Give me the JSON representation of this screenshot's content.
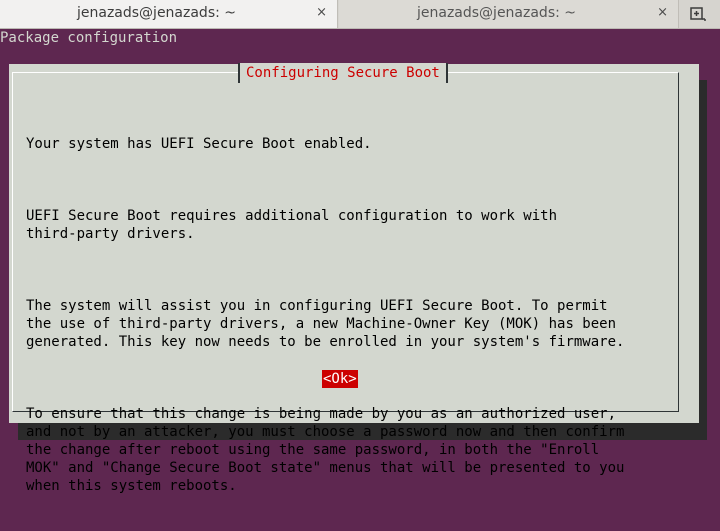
{
  "tabs": [
    {
      "title": "jenazads@jenazads: ~",
      "close": "×"
    },
    {
      "title": "jenazads@jenazads: ~",
      "close": "×"
    }
  ],
  "new_tab_icon": "new-tab-icon",
  "terminal": {
    "header_line": "Package configuration"
  },
  "dialog": {
    "title": "Configuring Secure Boot",
    "paragraphs": [
      "Your system has UEFI Secure Boot enabled.",
      "UEFI Secure Boot requires additional configuration to work with\nthird-party drivers.",
      "The system will assist you in configuring UEFI Secure Boot. To permit\nthe use of third-party drivers, a new Machine-Owner Key (MOK) has been\ngenerated. This key now needs to be enrolled in your system's firmware.",
      "To ensure that this change is being made by you as an authorized user,\nand not by an attacker, you must choose a password now and then confirm\nthe change after reboot using the same password, in both the \"Enroll\nMOK\" and \"Change Secure Boot state\" menus that will be presented to you\nwhen this system reboots."
    ],
    "ok_label": "<Ok>"
  },
  "colors": {
    "terminal_bg": "#5e2750",
    "dialog_bg": "#d3d7cf",
    "accent_red": "#cc0000"
  }
}
